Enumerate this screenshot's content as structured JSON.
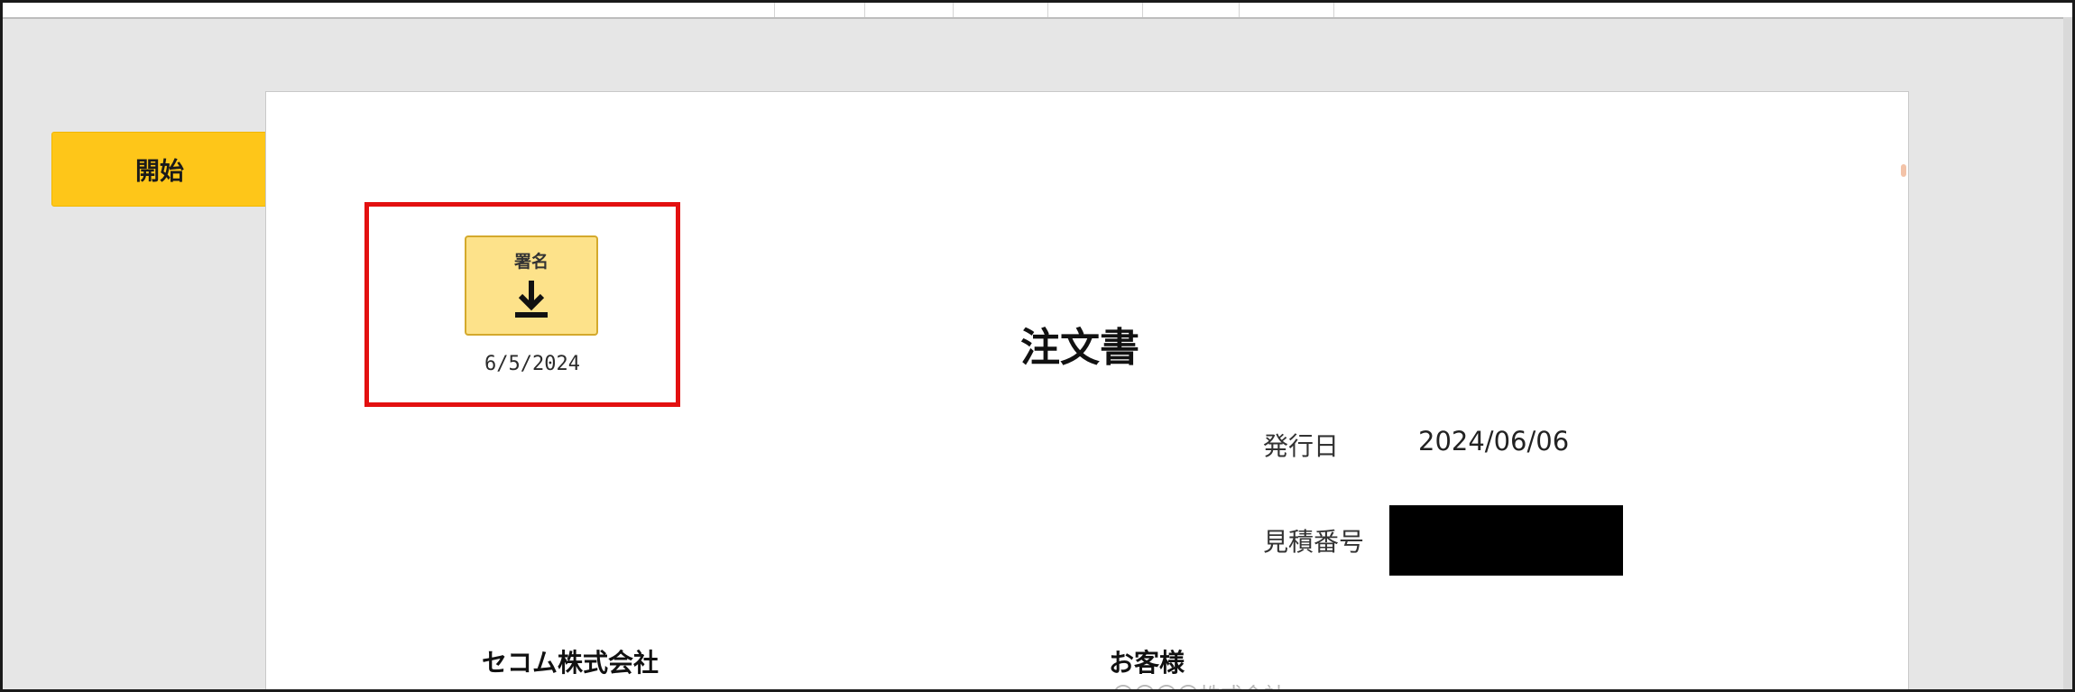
{
  "start_button": {
    "label": "開始"
  },
  "signature": {
    "label": "署名",
    "icon": "download-icon",
    "date": "6/5/2024"
  },
  "document": {
    "title": "注文書",
    "issue_date": {
      "label": "発行日",
      "value": "2024/06/06"
    },
    "quote_number": {
      "label": "見積番号",
      "value": ""
    },
    "issuer": "セコム株式会社",
    "customer_label": "お客様",
    "customer_name_partial": "〇〇〇〇株式会社"
  },
  "colors": {
    "start_button": "#fec619",
    "sign_button": "#fde28a",
    "highlight": "#e31010"
  }
}
